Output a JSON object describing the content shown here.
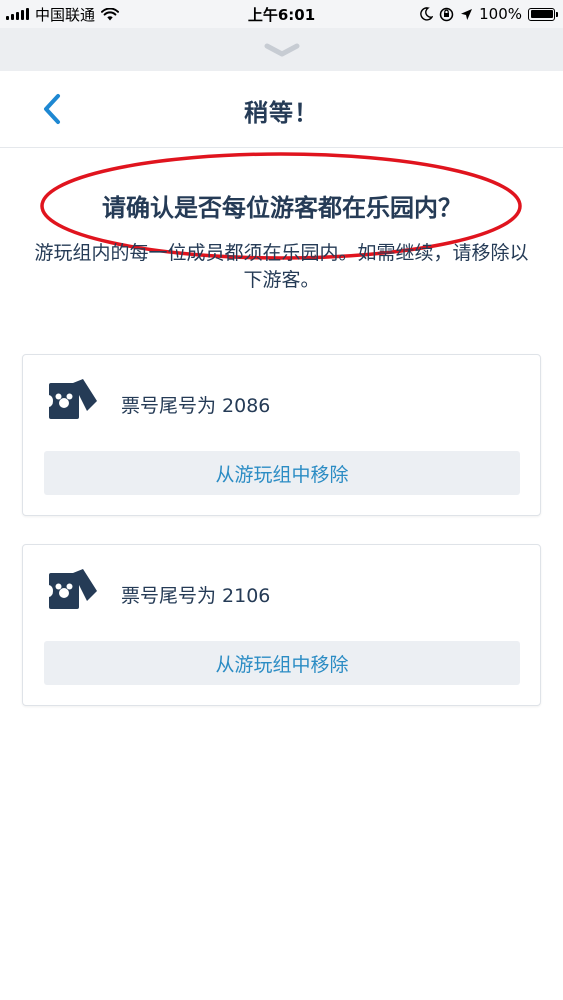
{
  "status_bar": {
    "carrier": "中国联通",
    "time": "上午6:01",
    "battery": "100%"
  },
  "header": {
    "title": "稍等！"
  },
  "content": {
    "question": "请确认是否每位游客都在乐园内？",
    "description": "游玩组内的每一位成员都须在乐园内。如需继续，请移除以下游客。"
  },
  "guests": [
    {
      "ticket_label": "票号尾号为 2086",
      "remove_label": "从游玩组中移除"
    },
    {
      "ticket_label": "票号尾号为 2106",
      "remove_label": "从游玩组中移除"
    }
  ],
  "colors": {
    "accent": "#1e88d2",
    "text": "#253b56",
    "highlight": "#e0141e"
  }
}
